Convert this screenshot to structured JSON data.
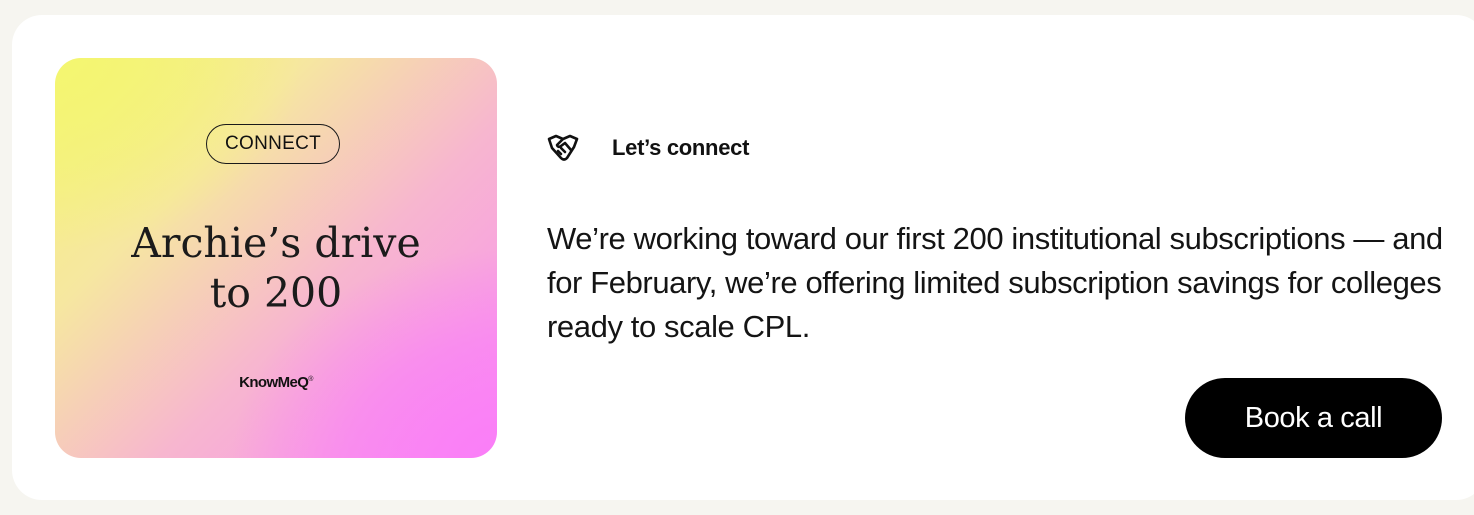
{
  "promo": {
    "badge": "CONNECT",
    "title": "Archie’s drive\nto 200",
    "brand": "KnowMeQ",
    "brand_mark": "®",
    "colors": {
      "gradient_yellow": "#f4f670",
      "gradient_pink": "#fa7df8"
    }
  },
  "section": {
    "icon": "handshake-icon",
    "label": "Let’s connect"
  },
  "message": "We’re working toward our first 200 institutional subscriptions — and for February, we’re offering limited subscription savings for colleges ready to scale CPL.",
  "cta": {
    "label": "Book a call",
    "color": "#000000"
  }
}
